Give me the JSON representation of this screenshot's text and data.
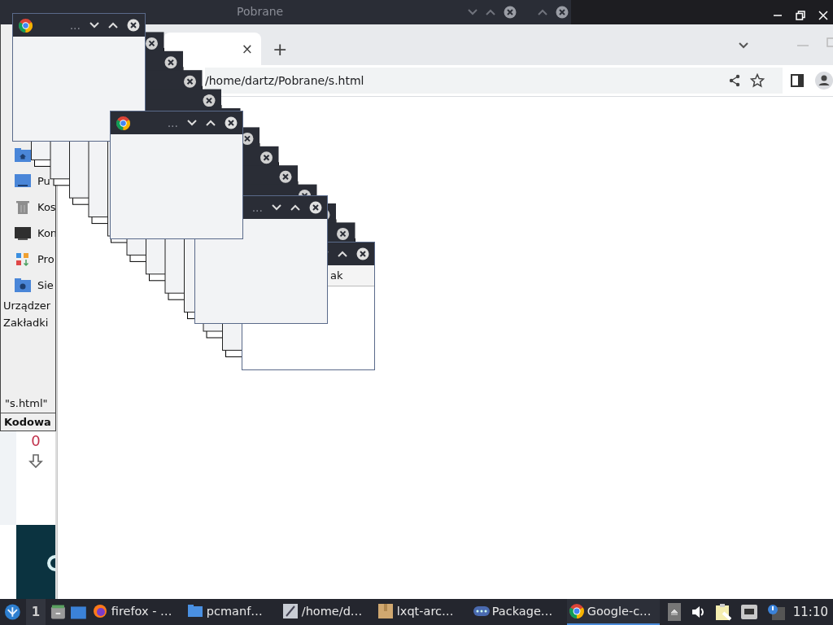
{
  "top_bar": {
    "title": "Pobrane"
  },
  "browser": {
    "tab_close": "×",
    "new_tab": "+",
    "address": "/home/dartz/Pobrane/s.html"
  },
  "file_manager": {
    "places": [
      {
        "kind": "home"
      },
      {
        "kind": "desktop",
        "label": "Pu"
      },
      {
        "kind": "trash",
        "label": "Kos"
      },
      {
        "kind": "computer",
        "label": "Kon"
      },
      {
        "kind": "apps",
        "label": "Pro"
      },
      {
        "kind": "network",
        "label": "Sie"
      }
    ],
    "sections": [
      "Urządzer",
      "Zakładki"
    ],
    "status": "\"s.html\"",
    "encoding": "Kodowa"
  },
  "side_panel": {
    "counter": "0"
  },
  "popups": [
    {
      "ellipsis": "..."
    },
    {
      "ellipsis": "..."
    },
    {
      "ellipsis": "..."
    },
    {
      "content": "ak"
    }
  ],
  "taskbar": {
    "workspace": "1",
    "tasks": [
      {
        "kind": "firefox",
        "label": "firefox - …",
        "selected": false
      },
      {
        "kind": "folder",
        "label": "pcmanf…",
        "selected": false
      },
      {
        "kind": "editor",
        "label": "/home/d…",
        "selected": false
      },
      {
        "kind": "archive",
        "label": "lxqt-arc…",
        "selected": false
      },
      {
        "kind": "package",
        "label": "Package…",
        "selected": false
      },
      {
        "kind": "chrome",
        "label": "Google-c…",
        "selected": true
      }
    ],
    "clock": "11:10"
  }
}
